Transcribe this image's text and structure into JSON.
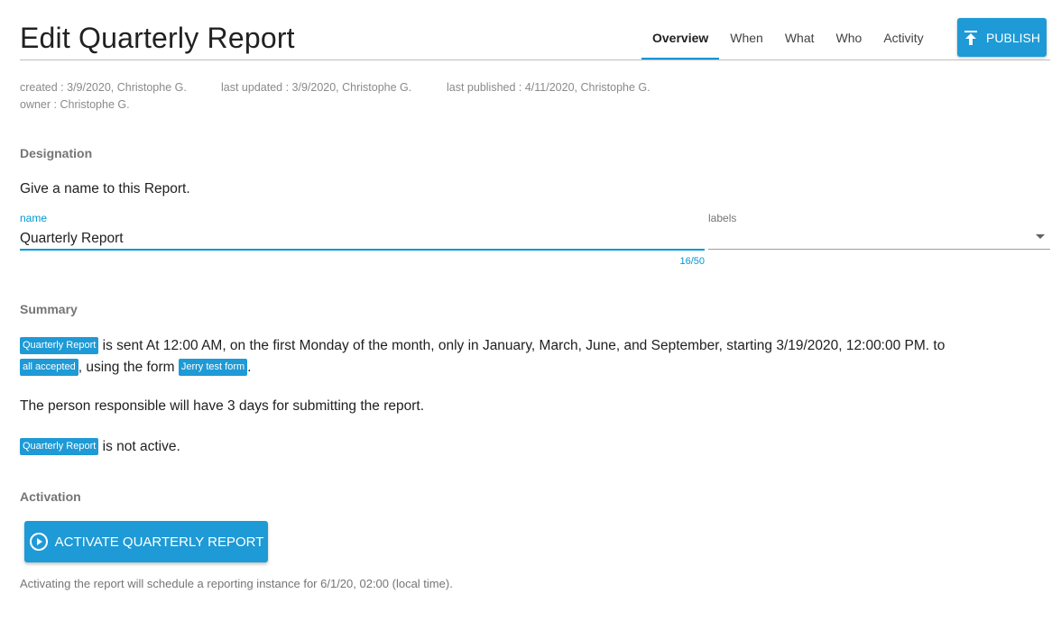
{
  "header": {
    "title": "Edit Quarterly Report",
    "tabs": [
      {
        "label": "Overview",
        "active": true
      },
      {
        "label": "When",
        "active": false
      },
      {
        "label": "What",
        "active": false
      },
      {
        "label": "Who",
        "active": false
      },
      {
        "label": "Activity",
        "active": false
      }
    ],
    "publish_label": "PUBLISH"
  },
  "meta": {
    "created": "created : 3/9/2020,  Christophe G.",
    "last_updated": "last updated : 3/9/2020,  Christophe G.",
    "last_published": "last published : 4/11/2020,  Christophe G.",
    "owner": "owner :  Christophe G."
  },
  "designation": {
    "section_label": "Designation",
    "prompt": "Give a name to this Report.",
    "name_label": "name",
    "name_value": "Quarterly Report",
    "name_counter": "16/50",
    "labels_label": "labels",
    "labels_value": ""
  },
  "summary": {
    "section_label": "Summary",
    "chip_report": "Quarterly Report",
    "sentence_part1": "is sent At 12:00 AM, on the first Monday of the month, only in January, March, June, and September, starting 3/19/2020, 12:00:00 PM. to",
    "chip_audience": "all accepted",
    "sentence_part2": ", using the form",
    "chip_form": "Jerry test form",
    "sentence_end": ".",
    "responsible_text": "The person responsible will have 3 days for submitting the report.",
    "status_chip": "Quarterly Report",
    "status_text": "is not active."
  },
  "activation": {
    "section_label": "Activation",
    "button_label": "ACTIVATE QUARTERLY REPORT",
    "hint": "Activating the report will schedule a reporting instance for 6/1/20, 02:00 (local time)."
  },
  "colors": {
    "accent": "#1e9ad6",
    "tab_underline": "#0097d6"
  },
  "icons": {
    "publish": "publish-upload-icon",
    "activate": "play-circle-icon",
    "labels_dropdown": "caret-down-icon"
  }
}
